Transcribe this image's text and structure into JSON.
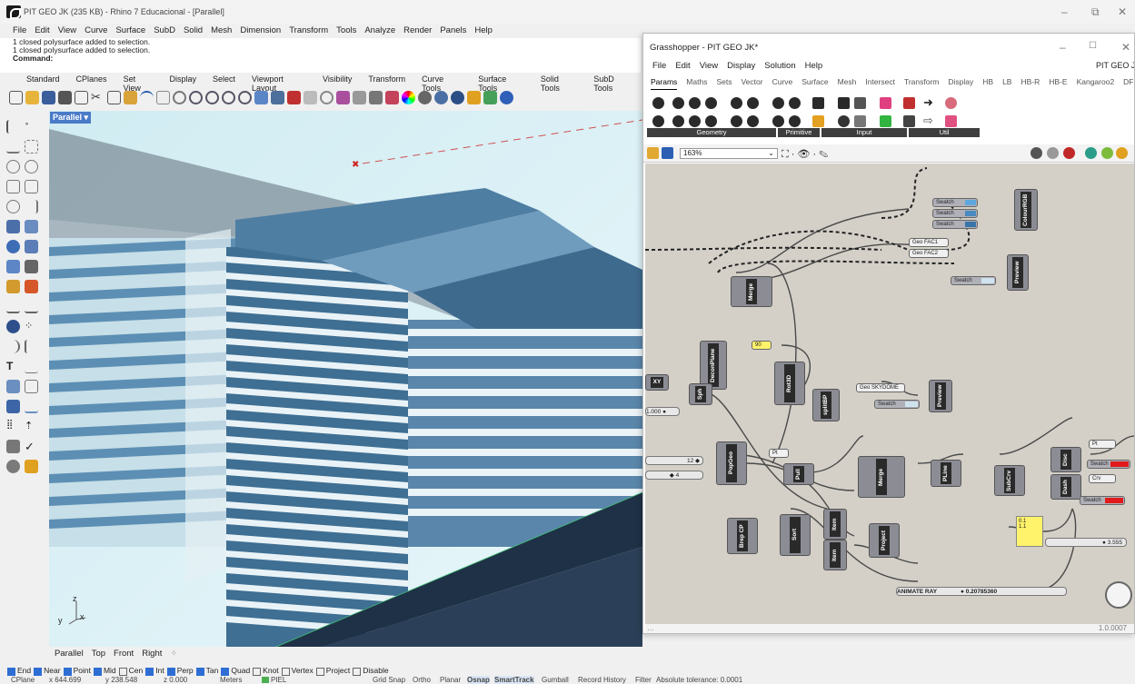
{
  "app": {
    "title": "PIT GEO JK (235 KB) - Rhino 7 Educacional - [Parallel]"
  },
  "menu": [
    "File",
    "Edit",
    "View",
    "Curve",
    "Surface",
    "SubD",
    "Solid",
    "Mesh",
    "Dimension",
    "Transform",
    "Tools",
    "Analyze",
    "Render",
    "Panels",
    "Help"
  ],
  "command_history": [
    "1 closed polysurface added to selection.",
    "1 closed polysurface added to selection."
  ],
  "command_prompt": "Command:",
  "toolbar_tabs": [
    "Standard",
    "CPlanes",
    "Set View",
    "Display",
    "Select",
    "Viewport Layout",
    "Visibility",
    "Transform",
    "Curve Tools",
    "Surface Tools",
    "Solid Tools",
    "SubD Tools"
  ],
  "viewport": {
    "name": "Parallel",
    "axes": {
      "z": "z",
      "y": "y",
      "x": "x"
    }
  },
  "view_tabs": [
    "Parallel",
    "Top",
    "Front",
    "Right"
  ],
  "osnaps": [
    {
      "label": "End",
      "on": true
    },
    {
      "label": "Near",
      "on": true
    },
    {
      "label": "Point",
      "on": true
    },
    {
      "label": "Mid",
      "on": true
    },
    {
      "label": "Cen",
      "on": false
    },
    {
      "label": "Int",
      "on": true
    },
    {
      "label": "Perp",
      "on": true
    },
    {
      "label": "Tan",
      "on": true
    },
    {
      "label": "Quad",
      "on": true
    },
    {
      "label": "Knot",
      "on": false
    },
    {
      "label": "Vertex",
      "on": false
    },
    {
      "label": "Project",
      "on": false
    },
    {
      "label": "Disable",
      "on": false
    }
  ],
  "status": {
    "cplane": "CPlane",
    "x": "x 644.699",
    "y": "y 238.548",
    "z": "z 0.000",
    "units": "Meters",
    "layer": "PIEL",
    "toggles": [
      "Grid Snap",
      "Ortho",
      "Planar",
      "Osnap",
      "SmartTrack",
      "Gumball",
      "Record History",
      "Filter"
    ],
    "tolerance": "Absolute tolerance: 0.0001"
  },
  "grasshopper": {
    "title": "Grasshopper - PIT GEO JK*",
    "menu": [
      "File",
      "Edit",
      "View",
      "Display",
      "Solution",
      "Help"
    ],
    "doc_name": "PIT GEO JK",
    "tabs": [
      "Params",
      "Maths",
      "Sets",
      "Vector",
      "Curve",
      "Surface",
      "Mesh",
      "Intersect",
      "Transform",
      "Display",
      "HB",
      "LB",
      "HB-R",
      "HB-E",
      "Kangaroo2",
      "DF"
    ],
    "categories": [
      "Geometry",
      "Primitive",
      "Input",
      "Util"
    ],
    "zoom": "163%",
    "version": "1.0.0007",
    "components": {
      "colour": "ColourRGB",
      "preview": "Preview",
      "merge": "Merge",
      "deplane": "DeconPlane",
      "xy": "XY",
      "sph": "Sph",
      "rot3d": "Rot3D",
      "splitbp": "splitBP",
      "popgeo": "PopGeo",
      "pull": "Pull",
      "pline": "PLine",
      "subcrv": "SubCrv",
      "disc": "Disc",
      "dash": "Dash",
      "brepcp": "Brep CP",
      "sort": "Sort",
      "item": "Item",
      "project": "Project"
    },
    "labels": {
      "swatch": "Swatch",
      "geofac1": "Geo FAC1",
      "geofac2": "Geo FAC2",
      "geosky": "Geo SKYDOME",
      "pt": "Pt",
      "crv": "Crv",
      "panel_val": "90",
      "slider_a": "12",
      "slider_b": "4",
      "slider_c": "1.000",
      "slider_d": "3.555",
      "anim_label": "ANIMATE RAY",
      "anim_val": "0.20785360",
      "yellow_vals": [
        "0.1",
        "1.1"
      ]
    }
  },
  "colors": {
    "accent": "#2e6ed4",
    "viewport_bg": "#d8eef3",
    "facade": "#5b8db2",
    "gh_canvas": "#d4d0c8"
  }
}
